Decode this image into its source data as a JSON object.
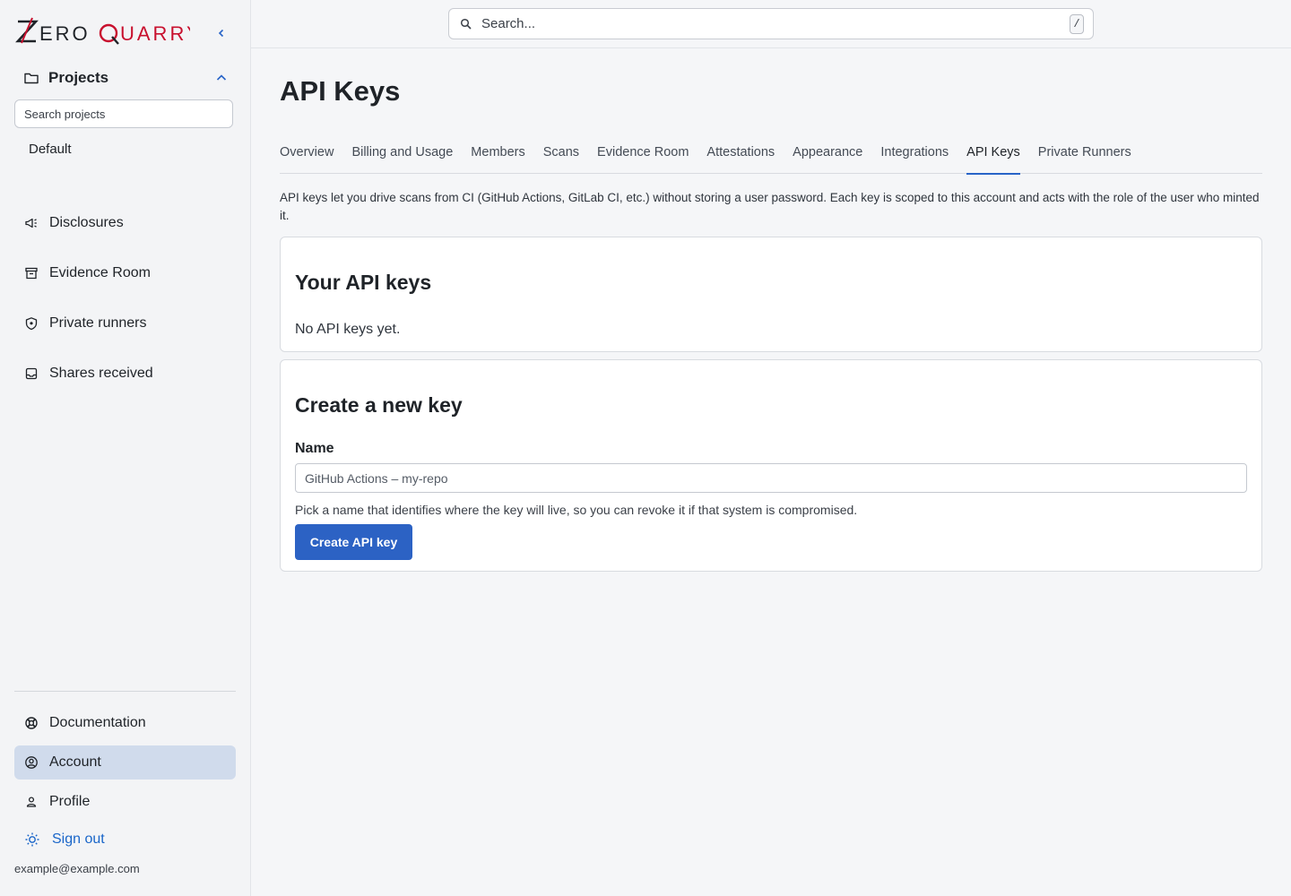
{
  "brand": {
    "name": "ZeroQuarry",
    "accent": "#c8102e"
  },
  "sidebar": {
    "projects_label": "Projects",
    "search_placeholder": "Search projects",
    "projects": [
      "Default"
    ],
    "nav": [
      {
        "label": "Disclosures",
        "icon": "megaphone-icon"
      },
      {
        "label": "Evidence Room",
        "icon": "archive-box-icon"
      },
      {
        "label": "Private runners",
        "icon": "shield-icon"
      },
      {
        "label": "Shares received",
        "icon": "inbox-icon"
      }
    ],
    "footer_nav": [
      {
        "label": "Documentation",
        "icon": "lifebuoy-icon"
      },
      {
        "label": "Account",
        "icon": "user-circle-icon",
        "active": true
      },
      {
        "label": "Profile",
        "icon": "user-icon"
      }
    ],
    "sign_out": "Sign out",
    "email": "example@example.com"
  },
  "topbar": {
    "search_placeholder": "Search...",
    "shortcut": "/"
  },
  "main": {
    "title": "API Keys",
    "tabs": [
      "Overview",
      "Billing and Usage",
      "Members",
      "Scans",
      "Evidence Room",
      "Attestations",
      "Appearance",
      "Integrations",
      "API Keys",
      "Private Runners"
    ],
    "active_tab": "API Keys",
    "intro": "API keys let you drive scans from CI (GitHub Actions, GitLab CI, etc.) without storing a user password. Each key is scoped to this account and acts with the role of the user who minted it.",
    "your_keys": {
      "heading": "Your API keys",
      "empty": "No API keys yet."
    },
    "create": {
      "heading": "Create a new key",
      "name_label": "Name",
      "name_placeholder": "GitHub Actions – my-repo",
      "help": "Pick a name that identifies where the key will live, so you can revoke it if that system is compromised.",
      "button": "Create API key"
    }
  }
}
